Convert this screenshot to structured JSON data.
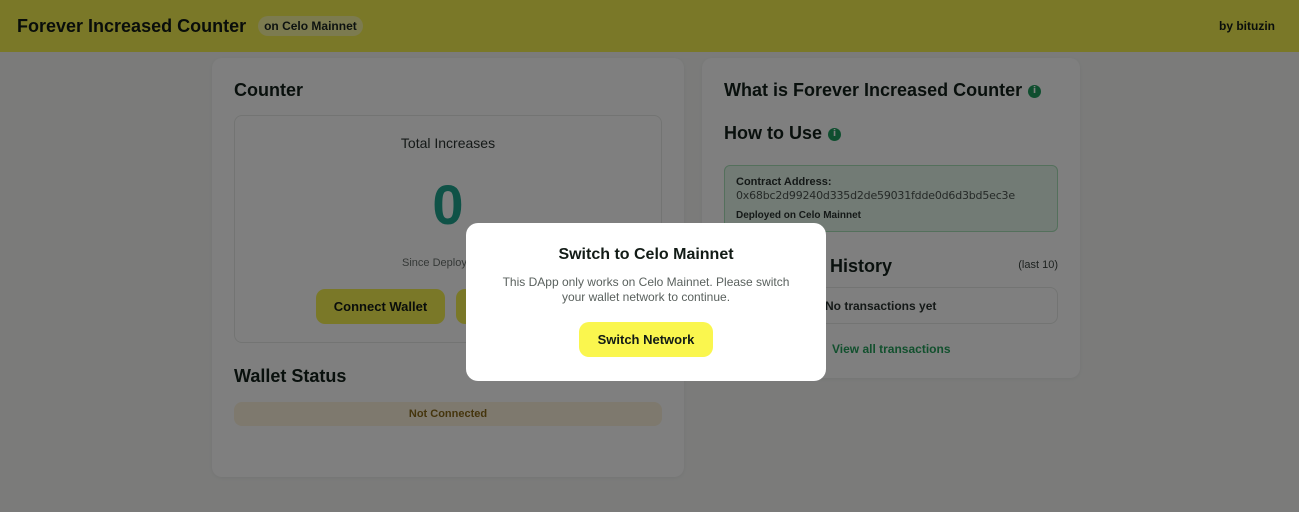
{
  "header": {
    "title": "Forever Increased Counter",
    "network_badge": "on Celo Mainnet",
    "author": "by bituzin"
  },
  "counter_card": {
    "title": "Counter",
    "total_label": "Total Increases",
    "total_value": "0",
    "since_text": "Since Deploy",
    "connect_button": "Connect Wallet"
  },
  "wallet_status": {
    "title": "Wallet Status",
    "status": "Not Connected"
  },
  "info_card": {
    "what_title": "What is Forever Increased Counter",
    "how_title": "How to Use",
    "info_icon": "i",
    "contract_label": "Contract Address:",
    "contract_address": "0x68bc2d99240d335d2de59031fdde0d6d3bd5ec3e",
    "deployed_note": "Deployed on Celo Mainnet",
    "history_title": "Transaction History",
    "history_scope": "(last 10)",
    "history_empty": "No transactions yet",
    "view_all": "View all transactions"
  },
  "modal": {
    "title": "Switch to Celo Mainnet",
    "message": "This DApp only works on Celo Mainnet. Please switch your wallet network to continue.",
    "button": "Switch Network"
  },
  "colors": {
    "brand_yellow": "#f5f050",
    "counter_teal": "#1ea48f",
    "info_green": "#1f9d5e"
  }
}
